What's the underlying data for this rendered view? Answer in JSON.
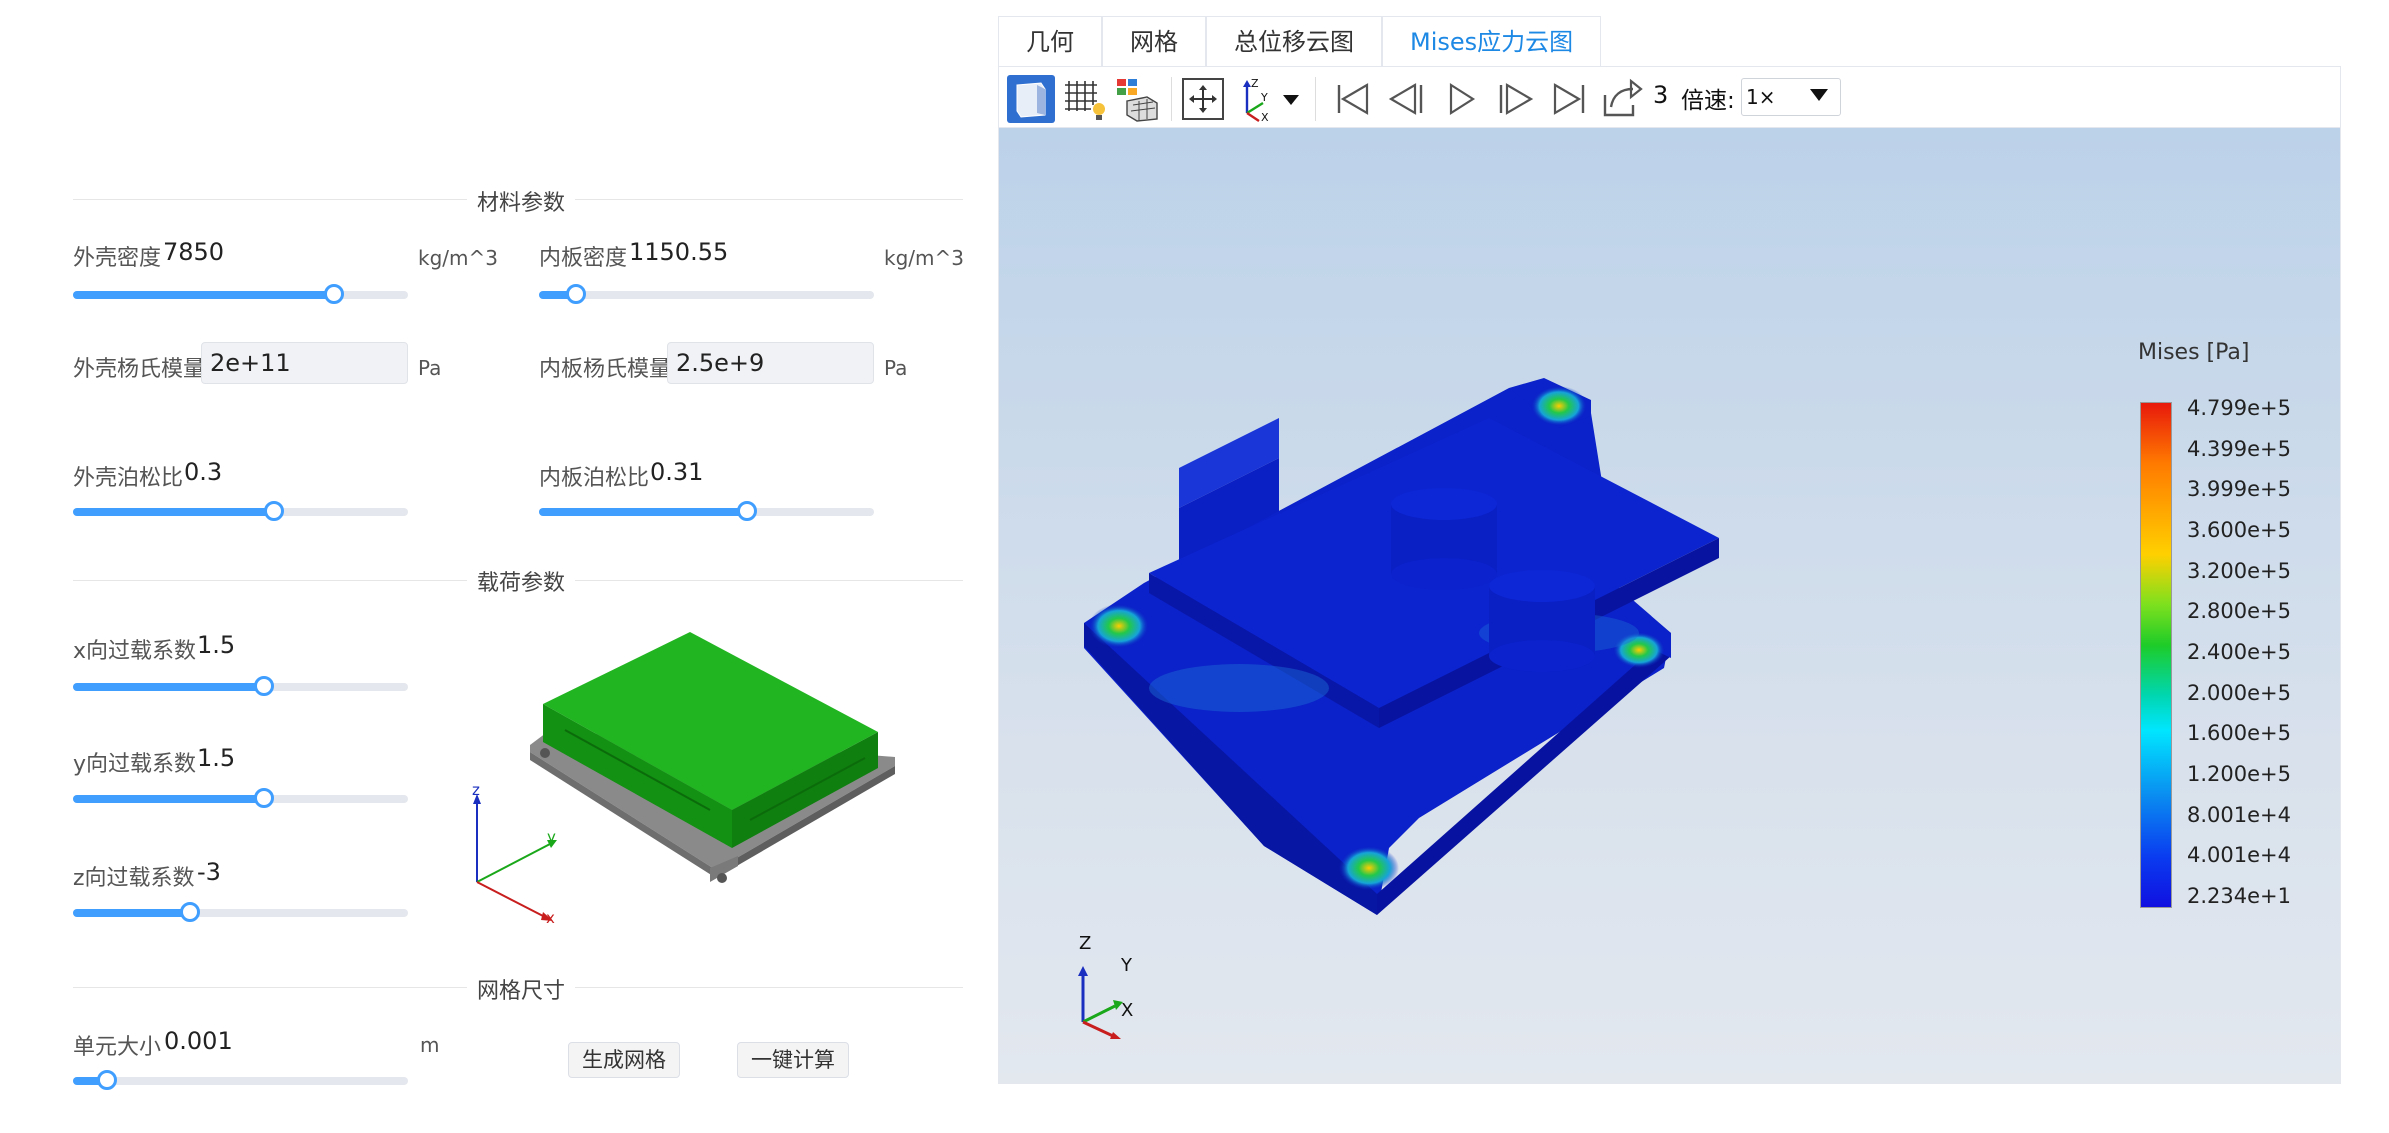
{
  "sections": {
    "material": "材料参数",
    "load": "载荷参数",
    "mesh": "网格尺寸"
  },
  "material": {
    "shell_density": {
      "label": "外壳密度",
      "value": "7850",
      "unit": "kg/m^3",
      "slider_fraction": 0.78
    },
    "plate_density": {
      "label": "内板密度",
      "value": "1150.55",
      "unit": "kg/m^3",
      "slider_fraction": 0.11
    },
    "shell_modulus": {
      "label": "外壳杨氏模量",
      "value": "2e+11",
      "unit": "Pa"
    },
    "plate_modulus": {
      "label": "内板杨氏模量",
      "value": "2.5e+9",
      "unit": "Pa"
    },
    "shell_poisson": {
      "label": "外壳泊松比",
      "value": "0.3",
      "slider_fraction": 0.6
    },
    "plate_poisson": {
      "label": "内板泊松比",
      "value": "0.31",
      "slider_fraction": 0.62
    }
  },
  "load": {
    "x_factor": {
      "label": "x向过载系数",
      "value": "1.5",
      "slider_fraction": 0.57
    },
    "y_factor": {
      "label": "y向过载系数",
      "value": "1.5",
      "slider_fraction": 0.57
    },
    "z_factor": {
      "label": "z向过载系数",
      "value": "-3",
      "slider_fraction": 0.35
    }
  },
  "mesh": {
    "element_size": {
      "label": "单元大小",
      "value": "0.001",
      "unit": "m",
      "slider_fraction": 0.1
    }
  },
  "preview_axes": {
    "z": "z",
    "y": "y",
    "x": "x"
  },
  "buttons": {
    "generate_mesh": "生成网格",
    "compute": "一键计算"
  },
  "tabs": [
    {
      "label": "几何",
      "active": false
    },
    {
      "label": "网格",
      "active": false
    },
    {
      "label": "总位移云图",
      "active": false
    },
    {
      "label": "Mises应力云图",
      "active": true
    }
  ],
  "toolbar": {
    "frame": "3",
    "speed_label": "倍速:",
    "speed_value": "1×",
    "icons": [
      "solid-view-icon",
      "mesh-light-icon",
      "color-map-icon",
      "fit-view-icon",
      "axis-orient-icon",
      "first-frame-icon",
      "prev-frame-icon",
      "play-icon",
      "next-frame-icon",
      "last-frame-icon",
      "export-icon"
    ]
  },
  "legend": {
    "title": "Mises [Pa]",
    "ticks": [
      "4.799e+5",
      "4.399e+5",
      "3.999e+5",
      "3.600e+5",
      "3.200e+5",
      "2.800e+5",
      "2.400e+5",
      "2.000e+5",
      "1.600e+5",
      "1.200e+5",
      "8.001e+4",
      "4.001e+4",
      "2.234e+1"
    ]
  },
  "view_axes": {
    "z": "Z",
    "y": "Y",
    "x": "X"
  },
  "colors": {
    "accent": "#409eff",
    "active_tab": "#1e88e5",
    "model_green": "#17a617",
    "model_blue": "#0a1fc4"
  }
}
